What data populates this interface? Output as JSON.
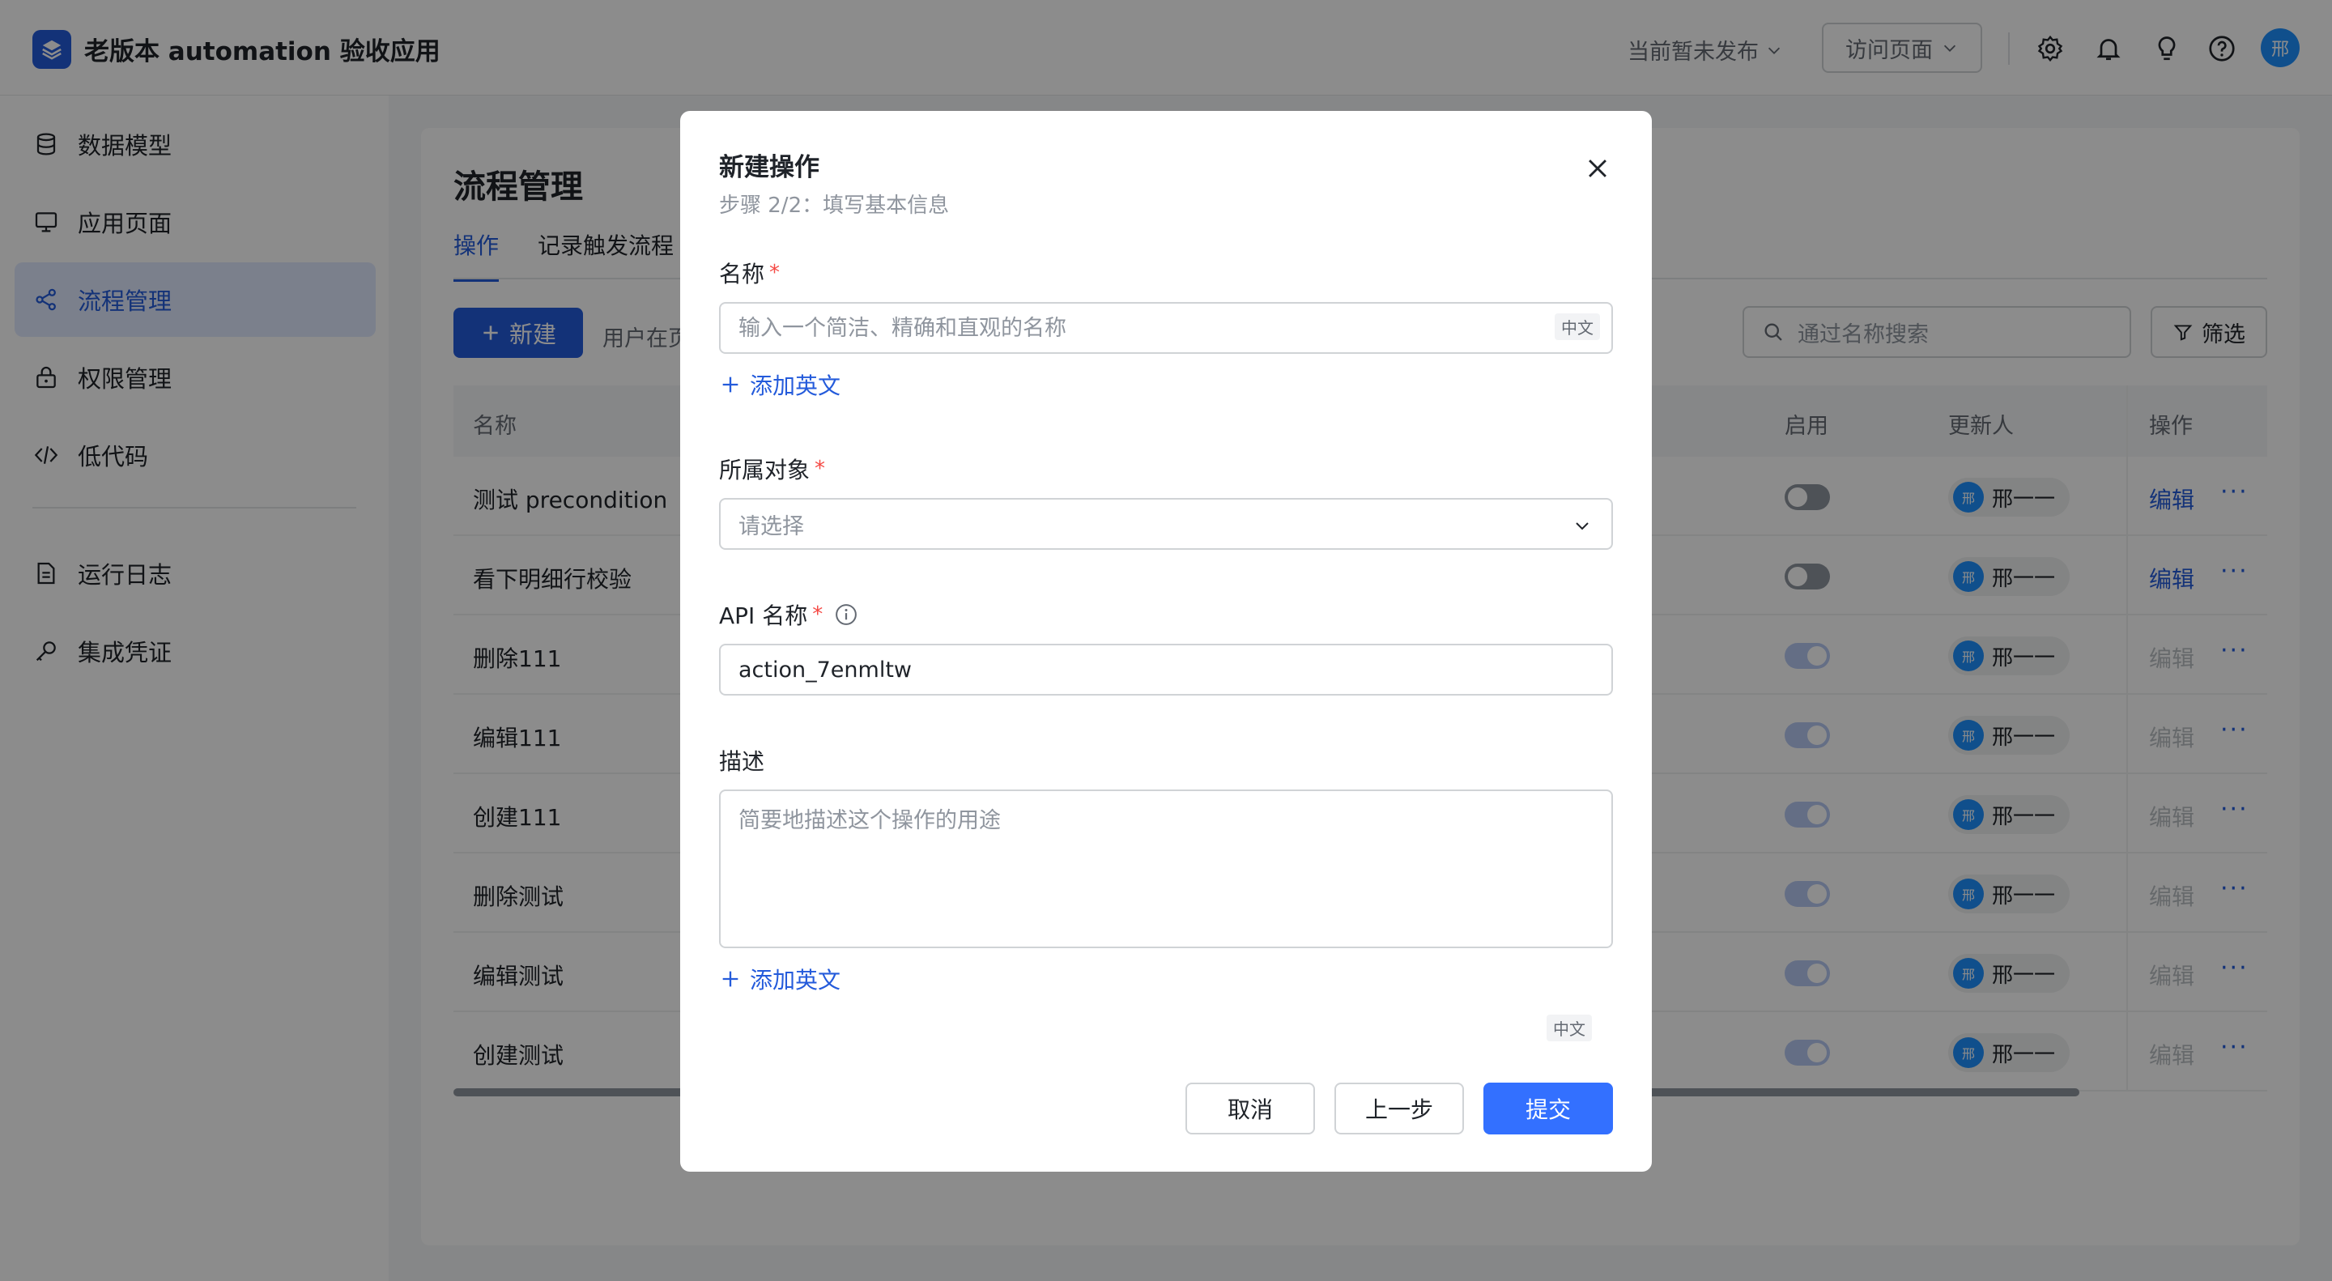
{
  "app": {
    "title": "老版本 automation 验收应用",
    "publish_status": "当前暂未发布",
    "visit_label": "访问页面",
    "avatar_text": "邢"
  },
  "sidebar": {
    "items": [
      {
        "label": "数据模型",
        "icon": "database-icon"
      },
      {
        "label": "应用页面",
        "icon": "monitor-icon"
      },
      {
        "label": "流程管理",
        "icon": "flow-icon"
      },
      {
        "label": "权限管理",
        "icon": "lock-icon"
      },
      {
        "label": "低代码",
        "icon": "code-icon"
      },
      {
        "label": "运行日志",
        "icon": "log-icon"
      },
      {
        "label": "集成凭证",
        "icon": "key-icon"
      }
    ],
    "active_index": 2
  },
  "main": {
    "title": "流程管理",
    "tabs": [
      {
        "label": "操作"
      },
      {
        "label": "记录触发流程"
      }
    ],
    "new_button": "新建",
    "hint": "用户在页",
    "search_placeholder": "通过名称搜索",
    "filter_label": "筛选",
    "columns": {
      "name": "名称",
      "enabled": "启用",
      "updater": "更新人",
      "actions": "操作"
    },
    "rows": [
      {
        "name": "测试 precondition",
        "updater": "邢一一",
        "edit": "编辑",
        "avatar": "邢"
      },
      {
        "name": "看下明细行校验",
        "updater": "邢一一",
        "edit": "编辑",
        "avatar": "邢"
      },
      {
        "name": "删除111",
        "updater": "邢一一",
        "edit": "编辑",
        "avatar": "邢"
      },
      {
        "name": "编辑111",
        "updater": "邢一一",
        "edit": "编辑",
        "avatar": "邢"
      },
      {
        "name": "创建111",
        "updater": "邢一一",
        "edit": "编辑",
        "avatar": "邢"
      },
      {
        "name": "删除测试",
        "updater": "邢一一",
        "edit": "编辑",
        "avatar": "邢"
      },
      {
        "name": "编辑测试",
        "updater": "邢一一",
        "edit": "编辑",
        "avatar": "邢"
      },
      {
        "name": "创建测试",
        "updater": "邢一一",
        "edit": "编辑",
        "avatar": "邢"
      }
    ],
    "more_label": "···"
  },
  "modal": {
    "title": "新建操作",
    "subtitle": "步骤 2/2：填写基本信息",
    "name_label": "名称",
    "name_placeholder": "输入一个简洁、精确和直观的名称",
    "lang_badge": "中文",
    "add_english": "添加英文",
    "object_label": "所属对象",
    "object_placeholder": "请选择",
    "api_label": "API 名称",
    "api_value": "action_7enmltw",
    "desc_label": "描述",
    "desc_placeholder": "简要地描述这个操作的用途",
    "required_mark": "*",
    "cancel": "取消",
    "prev": "上一步",
    "submit": "提交"
  },
  "colors": {
    "accent": "#245bdb",
    "primary_button": "#3370ff",
    "required": "#f54a45"
  }
}
